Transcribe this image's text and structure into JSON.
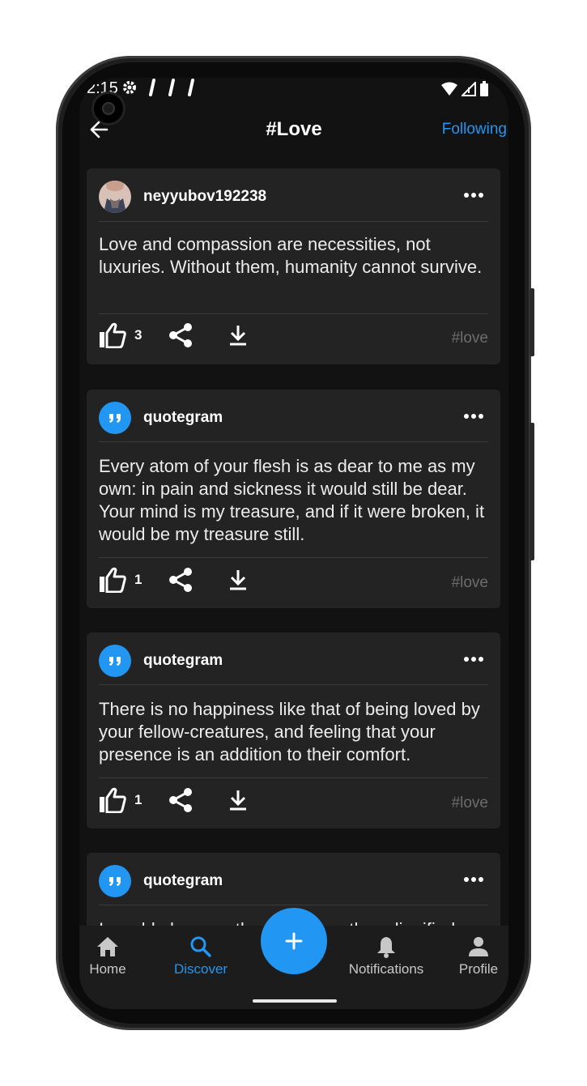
{
  "status_bar": {
    "time": "2:15"
  },
  "header": {
    "title": "#Love",
    "follow_label": "Following"
  },
  "posts": [
    {
      "username": "neyyubov192238",
      "avatar": "person-photo",
      "text": "Love and compassion are necessities, not luxuries. Without them, humanity cannot survive.",
      "likes": "3",
      "tag": "#love"
    },
    {
      "username": "quotegram",
      "avatar": "quote-icon",
      "text": "Every atom of your flesh is as dear to me as my own: in pain and sickness it would still be dear. Your mind is my treasure, and if it were broken, it would be my treasure still.",
      "likes": "1",
      "tag": "#love"
    },
    {
      "username": "quotegram",
      "avatar": "quote-icon",
      "text": "There is no happiness like that of being loved by your fellow-creatures, and feeling that your presence is an addition to their comfort.",
      "likes": "1",
      "tag": "#love"
    },
    {
      "username": "quotegram",
      "avatar": "quote-icon",
      "text": "I would always rather be happy than dignified."
    }
  ],
  "nav": {
    "home": "Home",
    "discover": "Discover",
    "notifications": "Notifications",
    "profile": "Profile"
  },
  "colors": {
    "accent": "#2196f3",
    "background": "#121212",
    "card": "#232323"
  }
}
